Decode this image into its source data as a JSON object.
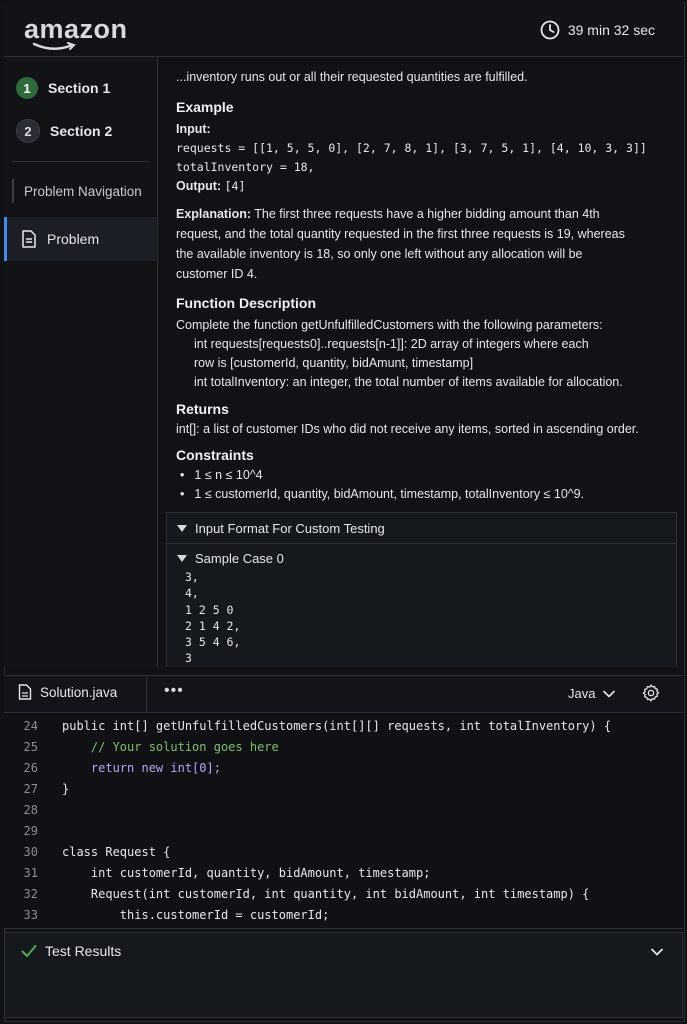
{
  "header": {
    "logo_text": "amazon",
    "timer": "39 min 32 sec"
  },
  "sidebar": {
    "sections": [
      {
        "number": "1",
        "label": "Section 1",
        "state": "active"
      },
      {
        "number": "2",
        "label": "Section 2",
        "state": "idle"
      }
    ],
    "nav_heading": "Problem Navigation",
    "nav_item": "Problem"
  },
  "problem": {
    "intro_line": "...inventory runs out or all their requested quantities are fulfilled.",
    "example_heading": "Example",
    "input_label": "Input:",
    "input_requests": "requests = [[1, 5, 5, 0], [2, 7, 8, 1], [3, 7, 5, 1], [4, 10, 3, 3]]",
    "input_total": "totalInventory = 18,",
    "output_label": "Output:",
    "output_value": "[4]",
    "explanation_label": "Explanation:",
    "explanation_lines": [
      "The first three requests have a higher bidding amount than 4th",
      "request, and the total quantity requested in the first three requests is 19, whereas",
      "the available inventory is 18, so only one left without any allocation will be",
      "customer ID 4."
    ],
    "function_heading": "Function Description",
    "function_lines": [
      "Complete the function getUnfulfilledCustomers with the following parameters:",
      "int requests[requests0]..requests[n-1]]: 2D array of integers where each",
      "row is [customerId, quantity, bidAmunt, timestamp]",
      "int totalInventory: an integer, the total number of items available for allocation."
    ],
    "returns_heading": "Returns",
    "returns_line": "int[]: a list of customer IDs who did not receive any items, sorted in ascending order.",
    "constraints_heading": "Constraints",
    "constraints": [
      "1 ≤ n ≤ 10^4",
      "1 ≤ customerId, quantity, bidAmount, timestamp, totalInventory ≤ 10^9."
    ],
    "custom_testing_label": "Input Format For Custom Testing",
    "sample_case_label": "Sample Case 0",
    "sample_lines": [
      "3,",
      "4,",
      "1 2 5 0",
      "2 1 4 2,",
      "3 5 4 6,",
      "3"
    ]
  },
  "editor": {
    "file_name": "Solution.java",
    "more_label": "•••",
    "language": "Java",
    "lines": [
      {
        "n": "24",
        "text": "public int[] getUnfulfilledCustomers(int[][] requests, int totalInventory) {"
      },
      {
        "n": "25",
        "text": "    // Your solution goes here"
      },
      {
        "n": "26",
        "text": "    return new int[0];"
      },
      {
        "n": "27",
        "text": "}"
      },
      {
        "n": "28",
        "text": ""
      },
      {
        "n": "29",
        "text": ""
      },
      {
        "n": "30",
        "text": "class Request {"
      },
      {
        "n": "31",
        "text": "    int customerId, quantity, bidAmount, timestamp;"
      },
      {
        "n": "32",
        "text": "    Request(int customerId, int quantity, int bidAmount, int timestamp) {"
      },
      {
        "n": "33",
        "text": "        this.customerId = customerId;"
      }
    ]
  },
  "results": {
    "label": "Test Results"
  },
  "colors": {
    "background": "#0f1114",
    "accent_blue": "#3a8df0",
    "section_active": "#2e6b3b",
    "check_green": "#4caf50",
    "keyword": "#b9a4f2",
    "comment": "#7fbf6a"
  }
}
